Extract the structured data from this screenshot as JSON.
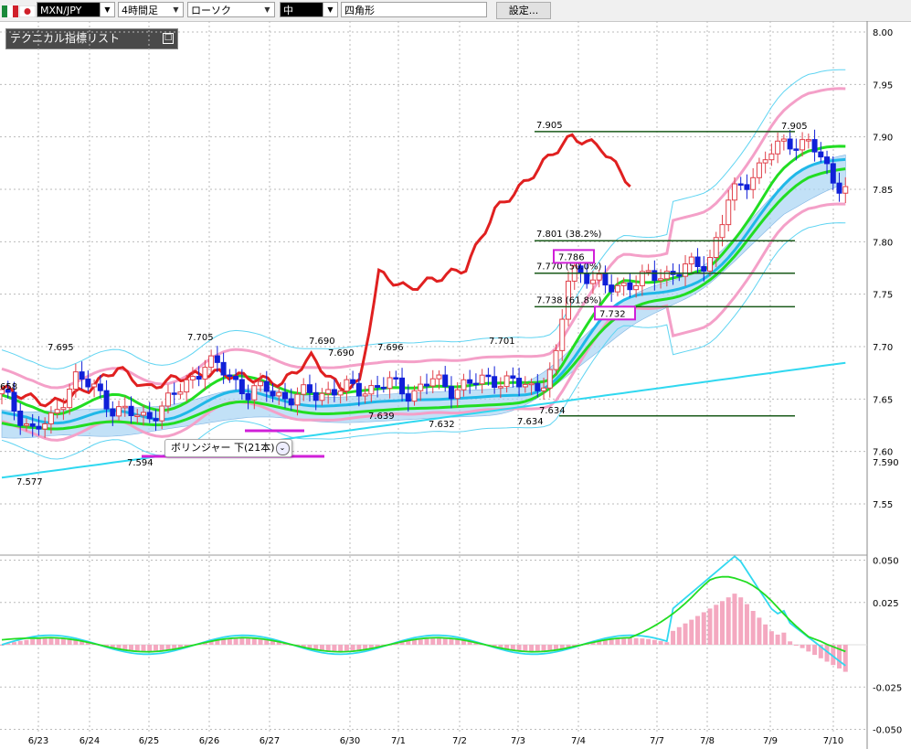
{
  "toolbar": {
    "symbol": "MXN/JPY",
    "timeframe": "4時間足",
    "chart_style": "ローソク",
    "line_width": "中",
    "drawing_tool": "四角形",
    "settings_label": "設定..."
  },
  "indicator_panel": {
    "title": "テクニカル指標リスト",
    "minimize": "□"
  },
  "tooltip": {
    "text": "ボリンジャー 下(21本)",
    "expand": "⌄"
  },
  "colors": {
    "bull_candle": "#e0404a",
    "bear_candle": "#1020d8",
    "bollinger": "#f4a0c8",
    "bollinger_mid": "#22dd22",
    "ichimoku_cloud": "#a8d4f4",
    "macd": "#30d8f0",
    "signal": "#22dd22",
    "histogram": "#f4a8c0",
    "fib": "#1a5a1a",
    "line_red": "#e02020"
  },
  "chart_data": [
    {
      "type": "candlestick",
      "title": "",
      "ylim": [
        7.55,
        8.0
      ],
      "y_ticks": [
        "8.00",
        "7.95",
        "7.90",
        "7.85",
        "7.80",
        "7.75",
        "7.70",
        "7.65",
        "7.60",
        "7.590",
        "7.55"
      ],
      "x_ticks": [
        "6/23",
        "6/24",
        "6/25",
        "6/26",
        "6/27",
        "6/30",
        "7/1",
        "7/2",
        "7/3",
        "7/4",
        "7/7",
        "7/8",
        "7/9",
        "7/10"
      ],
      "price_labels": [
        "7.695",
        "7.577",
        "7.594",
        "7.705",
        "7.690",
        "7.690",
        "7.639",
        "7.696",
        "7.632",
        "7.701",
        "7.634",
        "7.634",
        "7.905",
        "658"
      ],
      "fibonacci": [
        {
          "label": "7.905",
          "value": 7.905
        },
        {
          "label": "7.801 (38.2%)",
          "value": 7.801
        },
        {
          "label": "7.770 (50.0%)",
          "value": 7.77
        },
        {
          "label": "7.738 (61.8%)",
          "value": 7.738
        },
        {
          "label": "",
          "value": 7.634
        }
      ],
      "boxed_labels": [
        "7.786",
        "7.732"
      ]
    },
    {
      "type": "line",
      "title": "",
      "ylim": [
        -0.05,
        0.05
      ],
      "y_ticks": [
        "0.050",
        "0.025",
        "-0.025",
        "-0.050"
      ]
    }
  ]
}
